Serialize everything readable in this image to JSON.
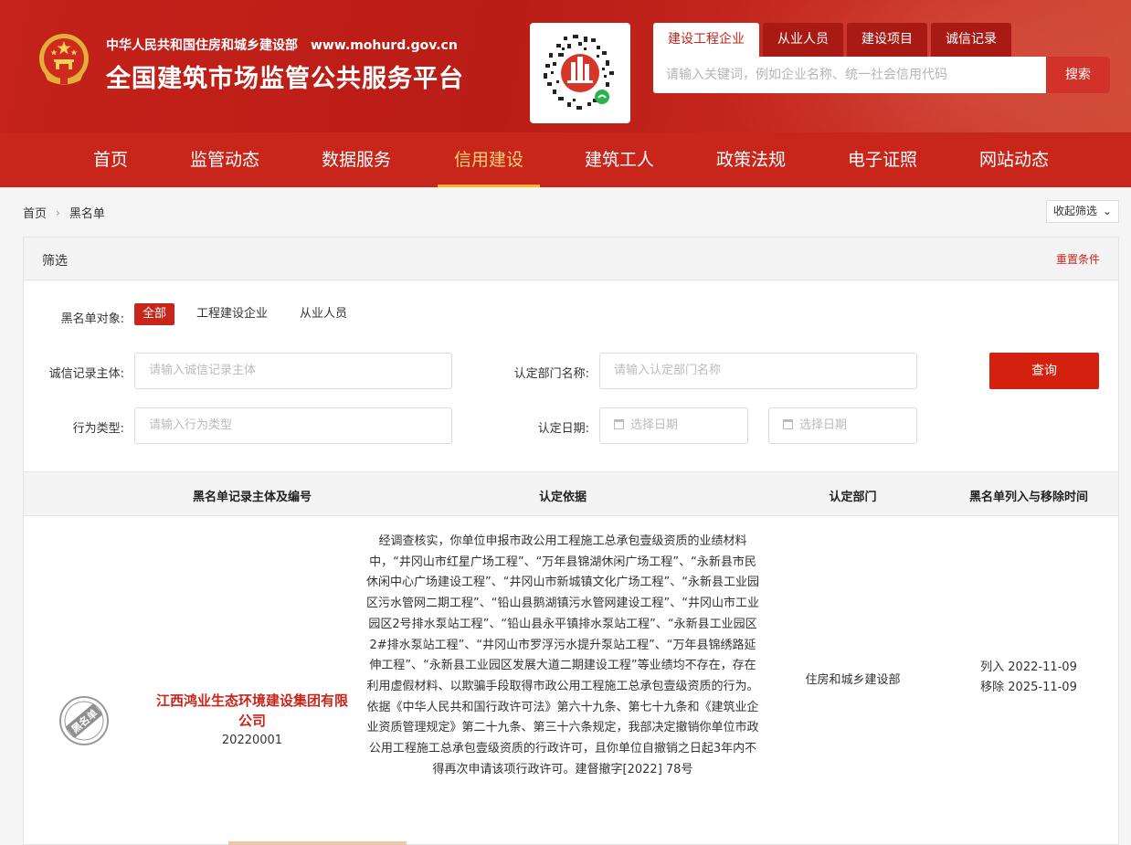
{
  "header": {
    "ministry": "中华人民共和国住房和城乡建设部",
    "url": "www.mohurd.gov.cn",
    "platform": "全国建筑市场监管公共服务平台"
  },
  "search": {
    "tabs": [
      {
        "label": "建设工程企业",
        "active": true
      },
      {
        "label": "从业人员",
        "active": false
      },
      {
        "label": "建设项目",
        "active": false
      },
      {
        "label": "诚信记录",
        "active": false
      }
    ],
    "placeholder": "请输入关键词，例如企业名称、统一社会信用代码",
    "button": "搜索"
  },
  "nav": [
    {
      "label": "首页",
      "active": false
    },
    {
      "label": "监管动态",
      "active": false
    },
    {
      "label": "数据服务",
      "active": false
    },
    {
      "label": "信用建设",
      "active": true
    },
    {
      "label": "建筑工人",
      "active": false
    },
    {
      "label": "政策法规",
      "active": false
    },
    {
      "label": "电子证照",
      "active": false
    },
    {
      "label": "网站动态",
      "active": false
    }
  ],
  "breadcrumb": {
    "home": "首页",
    "current": "黑名单"
  },
  "collapse_label": "收起筛选",
  "filter": {
    "title": "筛选",
    "reset": "重置条件",
    "object_label": "黑名单对象:",
    "object_options": [
      {
        "label": "全部",
        "active": true
      },
      {
        "label": "工程建设企业",
        "active": false
      },
      {
        "label": "从业人员",
        "active": false
      }
    ],
    "subject_label": "诚信记录主体:",
    "subject_placeholder": "请输入诚信记录主体",
    "dept_label": "认定部门名称:",
    "dept_placeholder": "请输入认定部门名称",
    "behavior_label": "行为类型:",
    "behavior_placeholder": "请输入行为类型",
    "date_label": "认定日期:",
    "date_start": "选择日期",
    "date_end": "选择日期",
    "query_button": "查询"
  },
  "table": {
    "headers": [
      "黑名单记录主体及编号",
      "认定依据",
      "认定部门",
      "黑名单列入与移除时间"
    ],
    "rows": [
      {
        "stamp": "黑名单",
        "entity": "江西鸿业生态环境建设集团有限公司",
        "code": "20220001",
        "basis": "经调查核实，你单位申报市政公用工程施工总承包壹级资质的业绩材料中，“井冈山市红星广场工程”、“万年县锦湖休闲广场工程”、“永新县市民休闲中心广场建设工程”、“井冈山市新城镇文化广场工程”、“永新县工业园区污水管网二期工程”、“铅山县鹅湖镇污水管网建设工程”、“井冈山市工业园区2号排水泵站工程”、“铅山县永平镇排水泵站工程”、“永新县工业园区2#排水泵站工程”、“井冈山市罗浮污水提升泵站工程”、“万年县锦绣路延伸工程”、“永新县工业园区发展大道二期建设工程”等业绩均不存在，存在利用虚假材料、以欺骗手段取得市政公用工程施工总承包壹级资质的行为。依据《中华人民共和国行政许可法》第六十九条、第七十九条和《建筑业企业资质管理规定》第二十九条、第三十六条规定，我部决定撤销你单位市政公用工程施工总承包壹级资质的行政许可，且你单位自撤销之日起3年内不得再次申请该项行政许可。建督撤字[2022] 78号",
        "dept": "住房和城乡建设部",
        "listed": "列入 2022-11-09",
        "removed": "移除 2025-11-09"
      }
    ]
  },
  "colors": {
    "brand_red": "#c8251b",
    "nav_active": "#ffd07a",
    "query_button": "#d3200f"
  }
}
